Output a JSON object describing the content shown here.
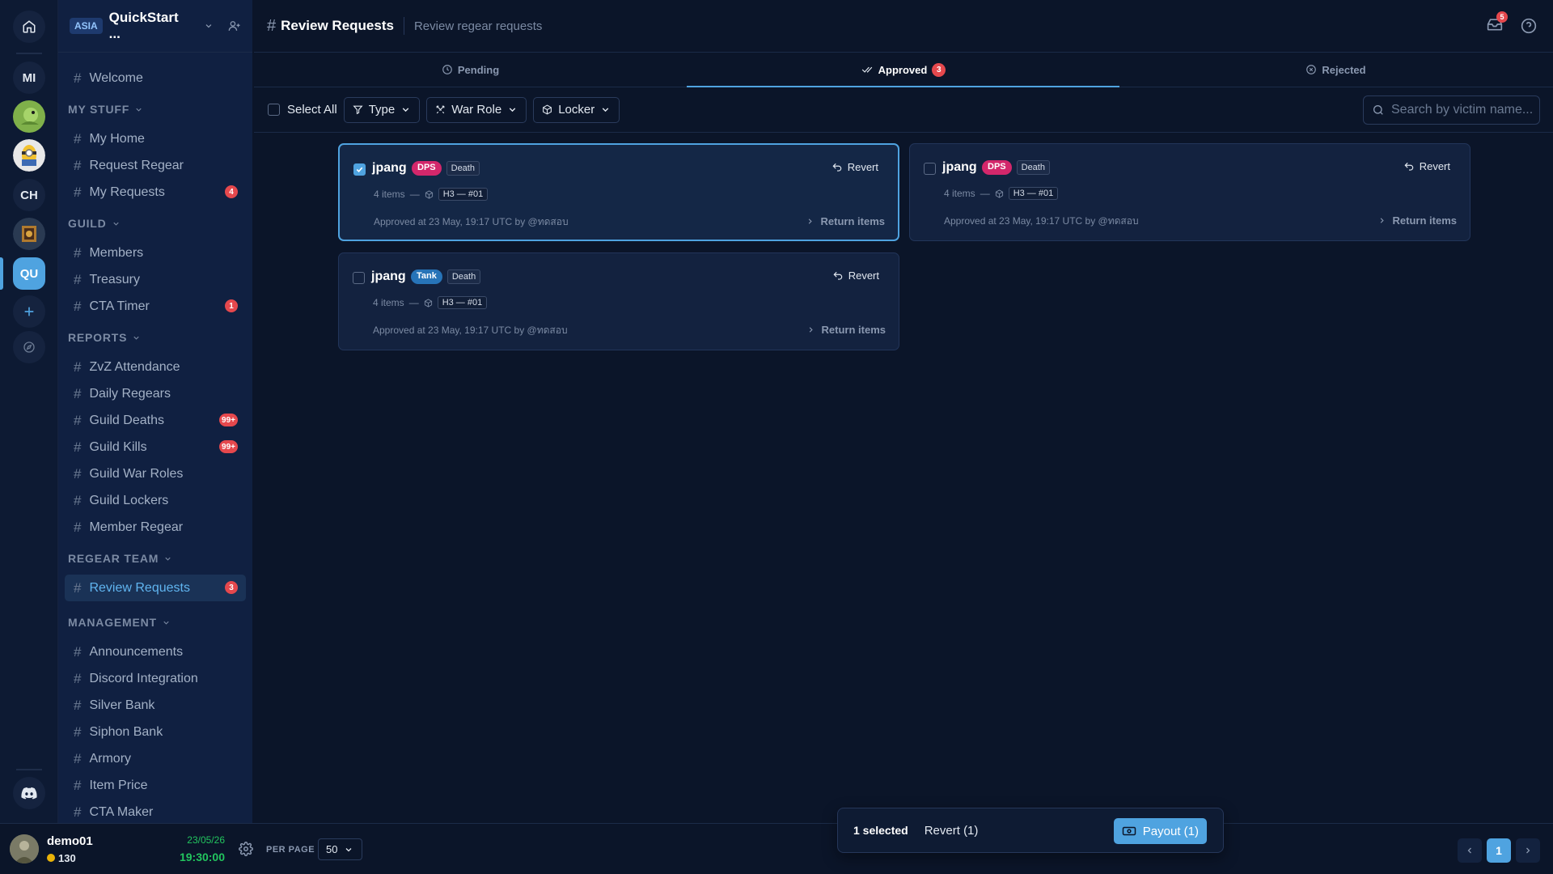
{
  "rail": {
    "initials_mi": "MI",
    "initials_ch": "CH",
    "initials_qu": "QU"
  },
  "server": {
    "region": "ASIA",
    "name": "QuickStart ..."
  },
  "nav": {
    "welcome": "Welcome",
    "sections": {
      "my_stuff": "MY STUFF",
      "guild": "GUILD",
      "reports": "REPORTS",
      "regear_team": "REGEAR TEAM",
      "management": "MANAGEMENT"
    },
    "my_stuff": [
      {
        "label": "My Home",
        "badge": ""
      },
      {
        "label": "Request Regear",
        "badge": ""
      },
      {
        "label": "My Requests",
        "badge": "4"
      }
    ],
    "guild": [
      {
        "label": "Members",
        "badge": ""
      },
      {
        "label": "Treasury",
        "badge": ""
      },
      {
        "label": "CTA Timer",
        "badge": "1"
      }
    ],
    "reports": [
      {
        "label": "ZvZ Attendance",
        "badge": ""
      },
      {
        "label": "Daily Regears",
        "badge": ""
      },
      {
        "label": "Guild Deaths",
        "badge": "99+"
      },
      {
        "label": "Guild Kills",
        "badge": "99+"
      },
      {
        "label": "Guild War Roles",
        "badge": ""
      },
      {
        "label": "Guild Lockers",
        "badge": ""
      },
      {
        "label": "Member Regear",
        "badge": ""
      }
    ],
    "regear_team": [
      {
        "label": "Review Requests",
        "badge": "3"
      }
    ],
    "management": [
      {
        "label": "Announcements"
      },
      {
        "label": "Discord Integration"
      },
      {
        "label": "Silver Bank"
      },
      {
        "label": "Siphon Bank"
      },
      {
        "label": "Armory"
      },
      {
        "label": "Item Price"
      },
      {
        "label": "CTA Maker"
      }
    ]
  },
  "user": {
    "name": "demo01",
    "coins": "130",
    "date": "23/05/26",
    "time": "19:30:00"
  },
  "header": {
    "hash": "#",
    "title": "Review Requests",
    "subtitle": "Review regear requests",
    "notifications": "5"
  },
  "tabs": [
    {
      "label": "Pending",
      "count": ""
    },
    {
      "label": "Approved",
      "count": "3"
    },
    {
      "label": "Rejected",
      "count": ""
    }
  ],
  "filters": {
    "select_all": "Select All",
    "type": "Type",
    "war_role": "War Role",
    "locker": "Locker",
    "search_placeholder": "Search by victim name..."
  },
  "cards": [
    {
      "name": "jpang",
      "role": "DPS",
      "kind": "Death",
      "items": "4 items",
      "dash": "—",
      "location": "H3 — #01",
      "approved": "Approved at 23 May, 19:17 UTC by @ทดสอบ",
      "revert": "Revert",
      "return": "Return items",
      "selected": true
    },
    {
      "name": "jpang",
      "role": "DPS",
      "kind": "Death",
      "items": "4 items",
      "dash": "—",
      "location": "H3 — #01",
      "approved": "Approved at 23 May, 19:17 UTC by @ทดสอบ",
      "revert": "Revert",
      "return": "Return items",
      "selected": false
    },
    {
      "name": "jpang",
      "role": "Tank",
      "kind": "Death",
      "items": "4 items",
      "dash": "—",
      "location": "H3 — #01",
      "approved": "Approved at 23 May, 19:17 UTC by @ทดสอบ",
      "revert": "Revert",
      "return": "Return items",
      "selected": false
    }
  ],
  "footer": {
    "per_page_label": "PER PAGE",
    "per_page": "50",
    "current_page": "1"
  },
  "actionbar": {
    "selected": "1 selected",
    "revert": "Revert (1)",
    "payout": "Payout (1)"
  },
  "colors": {
    "accent": "#4fa3e0",
    "badge": "#e5484d",
    "dps": "#d3276b",
    "tank": "#2774b8",
    "time": "#22c55e"
  }
}
